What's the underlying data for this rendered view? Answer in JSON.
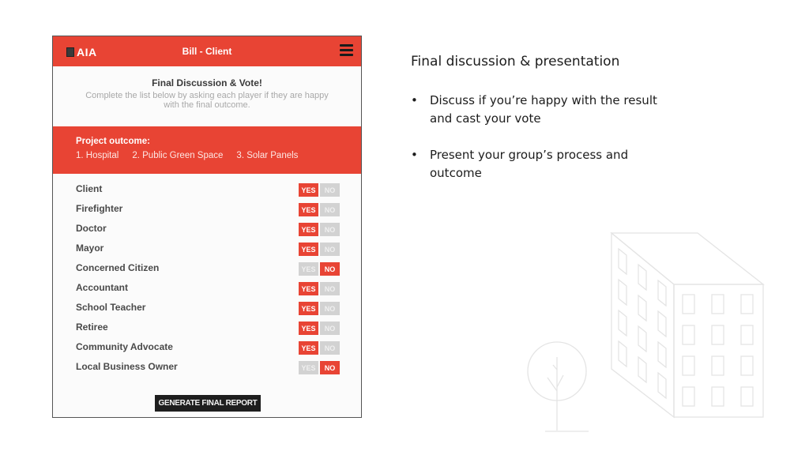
{
  "app": {
    "logo_text": "AIA",
    "title": "Bill - Client"
  },
  "intro": {
    "heading": "Final Discussion & Vote!",
    "instructions": "Complete the list below by asking each player if they are happy with the final outcome."
  },
  "outcome": {
    "label": "Project outcome:",
    "items": [
      "1. Hospital",
      "2. Public Green Space",
      "3. Solar Panels"
    ]
  },
  "vote_options": {
    "yes": "YES",
    "no": "NO"
  },
  "votes": [
    {
      "player": "Client",
      "vote": "yes"
    },
    {
      "player": "Firefighter",
      "vote": "yes"
    },
    {
      "player": "Doctor",
      "vote": "yes"
    },
    {
      "player": "Mayor",
      "vote": "yes"
    },
    {
      "player": "Concerned Citizen",
      "vote": "no"
    },
    {
      "player": "Accountant",
      "vote": "yes"
    },
    {
      "player": "School Teacher",
      "vote": "yes"
    },
    {
      "player": "Retiree",
      "vote": "yes"
    },
    {
      "player": "Community Advocate",
      "vote": "yes"
    },
    {
      "player": "Local Business Owner",
      "vote": "no"
    }
  ],
  "report_button": "GENERATE FINAL REPORT",
  "slide": {
    "title": "Final discussion & presentation",
    "bullets": [
      "Discuss if you’re happy with the result and cast your vote",
      "Present your group’s process and outcome"
    ],
    "bullet_glyph": "•"
  },
  "colors": {
    "accent": "#e84434",
    "inactive_button": "#d2d2d2",
    "report_button": "#1e1e1e"
  }
}
